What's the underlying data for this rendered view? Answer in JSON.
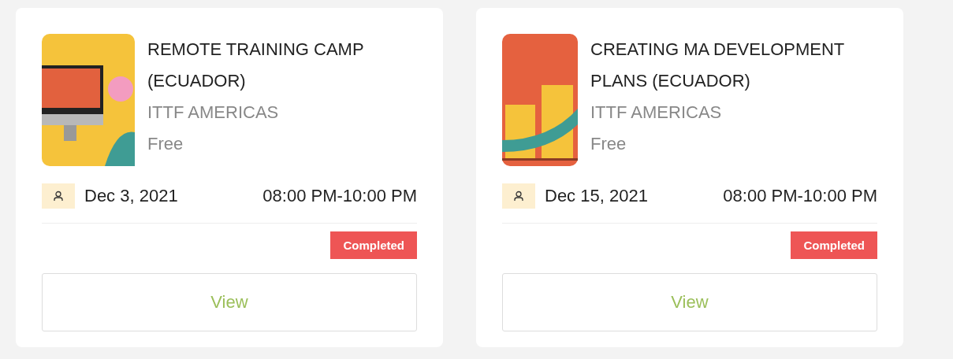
{
  "events": [
    {
      "image": {
        "kind": "desk"
      },
      "title": "REMOTE TRAINING CAMP (ECUADOR)",
      "organizer": "ITTF AMERICAS",
      "price": "Free",
      "date": "Dec 3, 2021",
      "time": "08:00 PM-10:00 PM",
      "status": "Completed",
      "button": "View"
    },
    {
      "image": {
        "kind": "chart"
      },
      "title": "CREATING MA DEVELOPMENT PLANS (ECUADOR)",
      "organizer": "ITTF AMERICAS",
      "price": "Free",
      "date": "Dec 15, 2021",
      "time": "08:00 PM-10:00 PM",
      "status": "Completed",
      "button": "View"
    }
  ]
}
